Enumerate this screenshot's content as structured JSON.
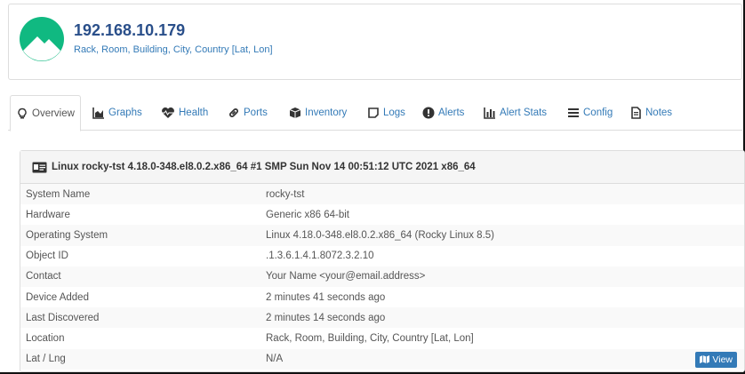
{
  "device": {
    "hostname": "192.168.10.179",
    "location": "Rack, Room, Building, City, Country [Lat, Lon]"
  },
  "tabs": [
    {
      "label": "Overview",
      "icon": "lightbulb-icon"
    },
    {
      "label": "Graphs",
      "icon": "area-chart-icon"
    },
    {
      "label": "Health",
      "icon": "heartbeat-icon"
    },
    {
      "label": "Ports",
      "icon": "link-icon"
    },
    {
      "label": "Inventory",
      "icon": "cube-icon"
    },
    {
      "label": "Logs",
      "icon": "sticky-note-icon"
    },
    {
      "label": "Alerts",
      "icon": "exclamation-circle-icon"
    },
    {
      "label": "Alert Stats",
      "icon": "bar-chart-icon"
    },
    {
      "label": "Config",
      "icon": "align-justify-icon"
    },
    {
      "label": "Notes",
      "icon": "file-text-icon"
    }
  ],
  "overview": {
    "title": "Linux rocky-tst 4.18.0-348.el8.0.2.x86_64 #1 SMP Sun Nov 14 00:51:12 UTC 2021 x86_64",
    "rows": [
      {
        "key": "System Name",
        "value": "rocky-tst"
      },
      {
        "key": "Hardware",
        "value": "Generic x86 64-bit"
      },
      {
        "key": "Operating System",
        "value": "Linux 4.18.0-348.el8.0.2.x86_64 (Rocky Linux 8.5)"
      },
      {
        "key": "Object ID",
        "value": ".1.3.6.1.4.1.8072.3.2.10"
      },
      {
        "key": "Contact",
        "value": "Your Name <your@email.address>"
      },
      {
        "key": "Device Added",
        "value": "2 minutes 41 seconds ago"
      },
      {
        "key": "Last Discovered",
        "value": "2 minutes 14 seconds ago"
      },
      {
        "key": "Location",
        "value": "Rack, Room, Building, City, Country [Lat, Lon]"
      },
      {
        "key": "Lat / Lng",
        "value": "N/A"
      }
    ],
    "view_button": "View"
  },
  "colors": {
    "link": "#337ab7",
    "hostname": "#2a4f8a",
    "logo": "#10b981",
    "view_button": "#337ab7"
  }
}
